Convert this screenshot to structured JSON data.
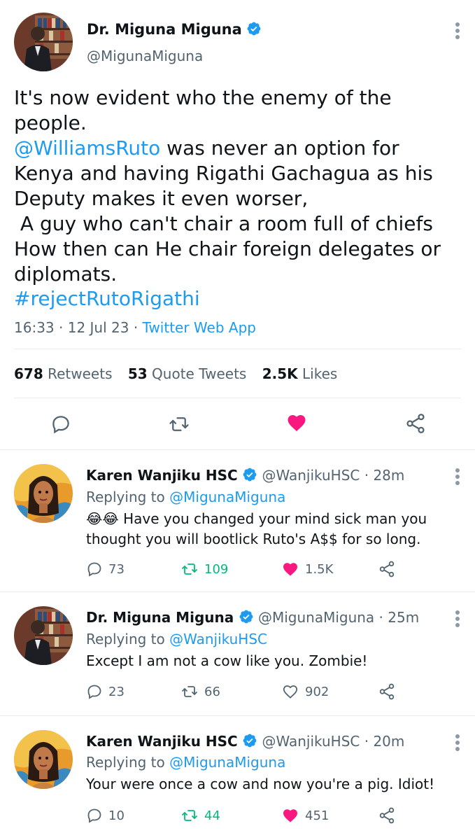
{
  "main_tweet": {
    "author_name": "Dr. Miguna Miguna",
    "author_handle": "@MigunaMiguna",
    "text_line1": "It's now evident who the enemy of the people.",
    "mention": "@WilliamsRuto",
    "text_line2_rest": " was never an option for",
    "text_line3": "Kenya and having Rigathi Gachagua as his",
    "text_line4": "Deputy makes it even worser,",
    "text_line5": " A guy who can't chair a room full of chiefs",
    "text_line6": "How then can He chair foreign delegates or",
    "text_line7": "diplomats.",
    "hashtag": "#rejectRutoRigathi",
    "time": "16:33",
    "date": "12 Jul 23",
    "source": "Twitter Web App",
    "retweets_count": "678",
    "retweets_label": "Retweets",
    "quotes_count": "53",
    "quotes_label": "Quote Tweets",
    "likes_count": "2.5K",
    "likes_label": "Likes"
  },
  "replies": [
    {
      "author_name": "Karen Wanjiku HSC",
      "author_handle": "@WanjikuHSC",
      "time_ago": "28m",
      "replying_prefix": "Replying to",
      "replying_to": "@MigunaMiguna",
      "emoji": "😂😂",
      "text_line1": " Have you changed your mind sick man you",
      "text_line2": "thought you will bootlick Ruto's A$$ for so long.",
      "reply_count": "73",
      "retweet_count": "109",
      "like_count": "1.5K",
      "liked": true
    },
    {
      "author_name": "Dr. Miguna Miguna",
      "author_handle": "@MigunaMiguna",
      "time_ago": "25m",
      "replying_prefix": "Replying to",
      "replying_to": "@WanjikuHSC",
      "text_line1": "Except I am not a cow like you. Zombie!",
      "reply_count": "23",
      "retweet_count": "66",
      "like_count": "902",
      "liked": false
    },
    {
      "author_name": "Karen Wanjiku HSC",
      "author_handle": "@WanjikuHSC",
      "time_ago": "20m",
      "replying_prefix": "Replying to",
      "replying_to": "@MigunaMiguna",
      "text_line1": "Your were once a cow and now you're a pig. Idiot!",
      "reply_count": "10",
      "retweet_count": "44",
      "like_count": "451",
      "liked": true
    }
  ],
  "separator": "·",
  "colors": {
    "link": "#1d9bf0",
    "like": "#f91880",
    "retweet_green": "#00ba7c",
    "secondary_text": "#536471",
    "verified": "#1d9bf0"
  },
  "icons": [
    "reply-icon",
    "retweet-icon",
    "heart-icon",
    "share-icon",
    "verified-badge-icon",
    "more-options-icon"
  ]
}
